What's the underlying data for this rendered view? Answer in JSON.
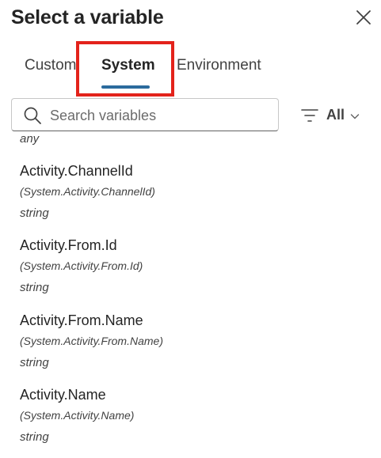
{
  "dialog": {
    "title": "Select a variable",
    "close_icon": "close-icon"
  },
  "tabs": [
    {
      "label": "Custom",
      "selected": false
    },
    {
      "label": "System",
      "selected": true
    },
    {
      "label": "Environment",
      "selected": false
    }
  ],
  "accent_color": "#2b6b9d",
  "highlight_color": "#e3231b",
  "search": {
    "value": "",
    "placeholder": "Search variables",
    "icon": "search-icon"
  },
  "filter": {
    "icon": "filter-icon",
    "label": "All",
    "chevron": "chevron-down-icon"
  },
  "list": {
    "partial_item_type": "any",
    "items": [
      {
        "name": "Activity.ChannelId",
        "path": "(System.Activity.ChannelId)",
        "type": "string"
      },
      {
        "name": "Activity.From.Id",
        "path": "(System.Activity.From.Id)",
        "type": "string"
      },
      {
        "name": "Activity.From.Name",
        "path": "(System.Activity.From.Name)",
        "type": "string"
      },
      {
        "name": "Activity.Name",
        "path": "(System.Activity.Name)",
        "type": "string"
      }
    ]
  }
}
